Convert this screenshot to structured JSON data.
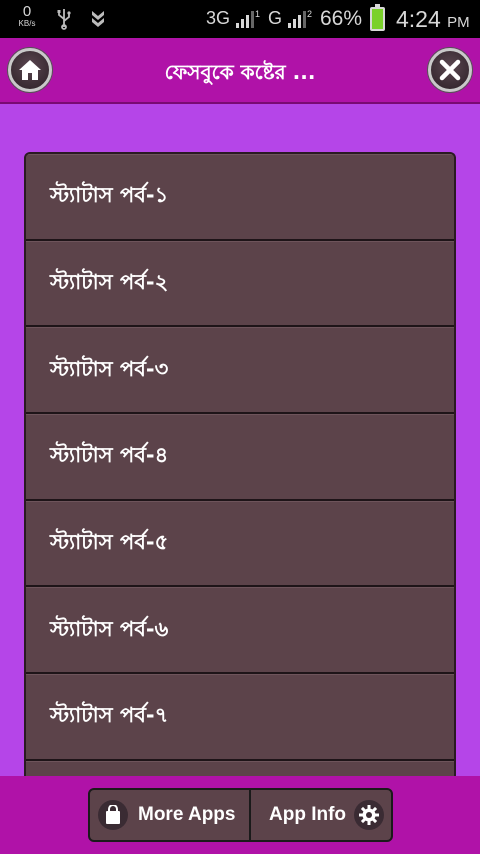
{
  "status_bar": {
    "net_speed_value": "0",
    "net_speed_unit": "KB/s",
    "signal1_label": "3G",
    "signal1_sup": "1",
    "signal2_label": "G",
    "signal2_sup": "2",
    "battery_percent": "66%",
    "time": "4:24",
    "ampm": "PM"
  },
  "header": {
    "title": "ফেসবুকে কষ্টের ..."
  },
  "list": {
    "items": [
      {
        "label": "স্ট্যাটাস পর্ব-১"
      },
      {
        "label": "স্ট্যাটাস পর্ব-২"
      },
      {
        "label": "স্ট্যাটাস পর্ব-৩"
      },
      {
        "label": "স্ট্যাটাস পর্ব-৪"
      },
      {
        "label": "স্ট্যাটাস পর্ব-৫"
      },
      {
        "label": "স্ট্যাটাস পর্ব-৬"
      },
      {
        "label": "স্ট্যাটাস পর্ব-৭"
      },
      {
        "label": ""
      }
    ]
  },
  "bottom_bar": {
    "more_apps_label": "More Apps",
    "app_info_label": "App Info"
  },
  "colors": {
    "background": "#b545e8",
    "header": "#b012a8",
    "list_item": "#5c434a"
  }
}
